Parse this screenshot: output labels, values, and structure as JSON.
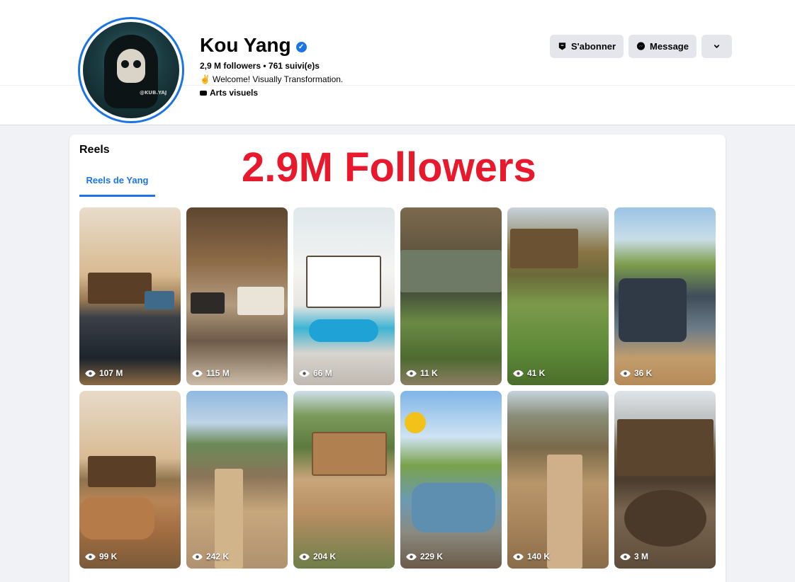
{
  "profile": {
    "name": "Kou Yang",
    "stats": "2,9 M followers • 761 suivi(e)s",
    "bio_emoji": "✌",
    "bio": "Welcome! Visually Transformation.",
    "category": "Arts visuels",
    "avatar_tag": "@KUB.YAJ"
  },
  "actions": {
    "subscribe": "S'abonner",
    "message": "Message"
  },
  "reels": {
    "title": "Reels",
    "tab": "Reels de Yang",
    "overlay": "2.9M Followers",
    "tiles": [
      {
        "views": "107 M"
      },
      {
        "views": "115 M"
      },
      {
        "views": "66 M"
      },
      {
        "views": "11 K"
      },
      {
        "views": "41 K"
      },
      {
        "views": "36 K"
      },
      {
        "views": "99 K"
      },
      {
        "views": "242 K"
      },
      {
        "views": "204 K"
      },
      {
        "views": "229 K"
      },
      {
        "views": "140 K"
      },
      {
        "views": "3 M"
      }
    ]
  },
  "colors": {
    "accent": "#1b74e4",
    "overlay_red": "#e8192c",
    "button_bg": "#e4e6eb",
    "page_bg": "#f0f2f5"
  },
  "icons": {
    "verified": "verified-badge-icon",
    "subscribe": "shield-icon",
    "message": "messenger-icon",
    "more": "chevron-down-icon",
    "views": "eye-icon"
  }
}
